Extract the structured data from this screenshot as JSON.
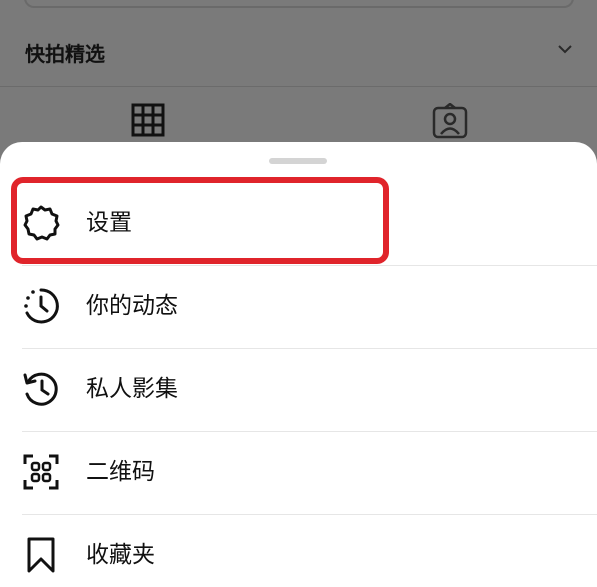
{
  "background": {
    "highlights_title": "快拍精选",
    "chevron_icon": "chevron-down-icon",
    "tabs": [
      {
        "icon": "grid-icon"
      },
      {
        "icon": "tagged-person-icon"
      }
    ]
  },
  "sheet": {
    "items": [
      {
        "label": "设置",
        "icon": "settings-gear-icon",
        "highlighted": true
      },
      {
        "label": "你的动态",
        "icon": "activity-clock-icon"
      },
      {
        "label": "私人影集",
        "icon": "archive-history-icon"
      },
      {
        "label": "二维码",
        "icon": "qr-code-icon"
      },
      {
        "label": "收藏夹",
        "icon": "bookmark-icon"
      }
    ]
  },
  "colors": {
    "overlay": "#7a7a7a",
    "sheet": "#ffffff",
    "highlight": "#e0242b",
    "text": "#111111"
  }
}
